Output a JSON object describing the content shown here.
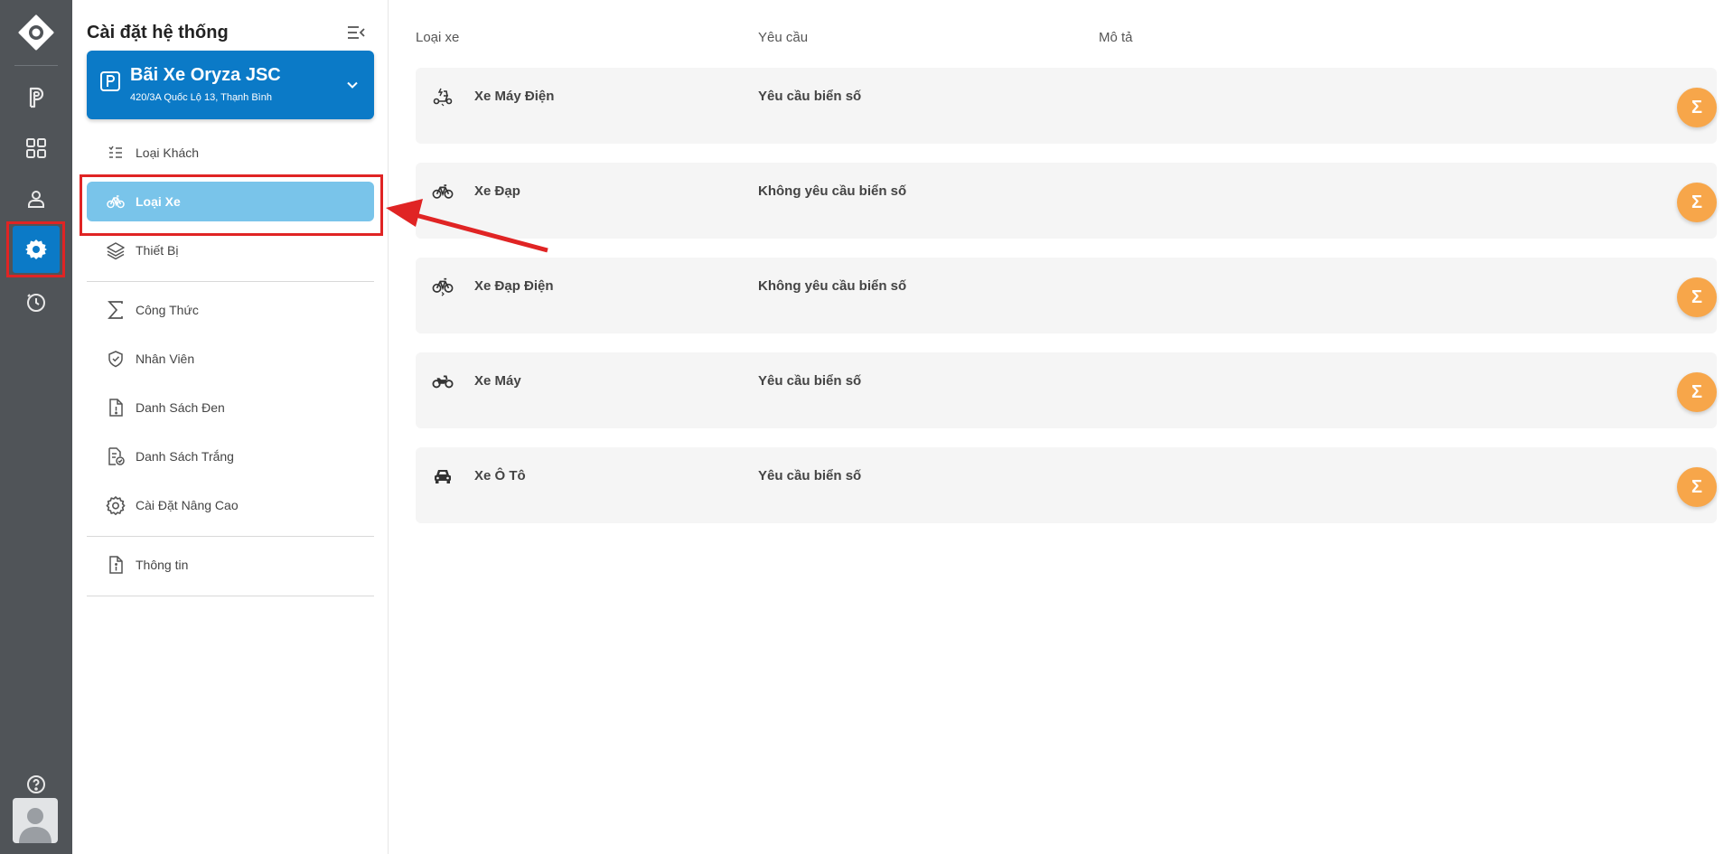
{
  "sidebar": {
    "title": "Cài đặt hệ thống",
    "lot": {
      "name": "Bãi Xe Oryza JSC",
      "address": "420/3A Quốc Lộ 13, Thạnh Bình"
    },
    "items": [
      {
        "label": "Loại Khách",
        "icon": "list-icon"
      },
      {
        "label": "Loại Xe",
        "icon": "bicycle-icon"
      },
      {
        "label": "Thiết Bị",
        "icon": "layers-icon"
      },
      {
        "label": "Công Thức",
        "icon": "sigma-icon"
      },
      {
        "label": "Nhân Viên",
        "icon": "shield-check-icon"
      },
      {
        "label": "Danh Sách Đen",
        "icon": "file-alert-icon"
      },
      {
        "label": "Danh Sách Trắng",
        "icon": "file-check-icon"
      },
      {
        "label": "Cài Đặt Nâng Cao",
        "icon": "gear-icon"
      },
      {
        "label": "Thông tin",
        "icon": "file-info-icon"
      }
    ],
    "active": "Loại Xe"
  },
  "table": {
    "headers": [
      "Loại xe",
      "Yêu cầu",
      "Mô tả"
    ],
    "rows": [
      {
        "name": "Xe Máy Điện",
        "requirement": "Yêu cầu biển số",
        "description": "",
        "icon": "electric-scooter-icon"
      },
      {
        "name": "Xe Đạp",
        "requirement": "Không yêu cầu biển số",
        "description": "",
        "icon": "bicycle-icon"
      },
      {
        "name": "Xe Đạp Điện",
        "requirement": "Không yêu cầu biển số",
        "description": "",
        "icon": "electric-bicycle-icon"
      },
      {
        "name": "Xe Máy",
        "requirement": "Yêu cầu biển số",
        "description": "",
        "icon": "motorbike-icon"
      },
      {
        "name": "Xe Ô Tô",
        "requirement": "Yêu cầu biển số",
        "description": "",
        "icon": "car-icon"
      }
    ],
    "formula_button_glyph": "Σ"
  },
  "colors": {
    "rail": "#505458",
    "accent": "#0b7ac7",
    "active_item": "#79c4ea",
    "formula": "#f7a64a",
    "highlight": "#e02424"
  }
}
